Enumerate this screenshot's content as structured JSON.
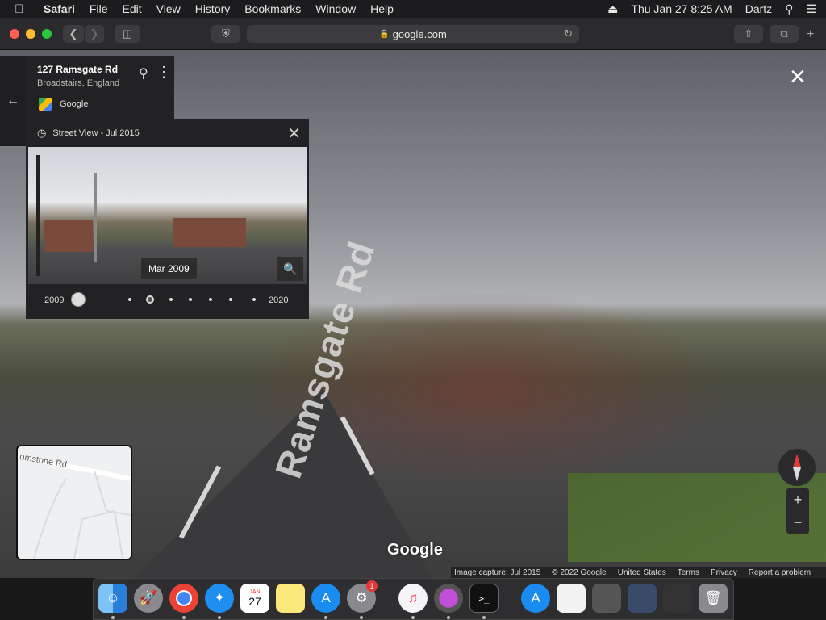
{
  "menubar": {
    "app": "Safari",
    "items": [
      "File",
      "Edit",
      "View",
      "History",
      "Bookmarks",
      "Window",
      "Help"
    ],
    "datetime": "Thu Jan 27  8:25 AM",
    "user": "Dartz"
  },
  "browser": {
    "url": "google.com"
  },
  "place": {
    "title": "127 Ramsgate Rd",
    "subtitle": "Broadstairs, England",
    "provider": "Google"
  },
  "timemachine": {
    "header": "Street View - Jul 2015",
    "preview_date": "Mar 2009",
    "start_year": "2009",
    "end_year": "2020",
    "ticks": 9,
    "selected_tick": 0,
    "highlighted_tick": 3
  },
  "minimap": {
    "road_label": "omstone Rd"
  },
  "street": {
    "road_label": "Ramsgate Rd",
    "logo": "Google"
  },
  "footer": {
    "capture": "Image capture: Jul 2015",
    "copyright": "© 2022 Google",
    "region": "United States",
    "terms": "Terms",
    "privacy": "Privacy",
    "report": "Report a problem"
  },
  "dock": {
    "apps": [
      "Finder",
      "Launchpad",
      "Chrome",
      "Safari",
      "Calendar",
      "Notes",
      "App Store",
      "System Preferences",
      "Music",
      "Installer",
      "Terminal",
      "Applications",
      "Documents",
      "Screenshots",
      "Preview",
      "Photos",
      "Trash"
    ],
    "calendar_month": "JAN",
    "calendar_day": "27",
    "badge_count": "1",
    "colors": {
      "finder": "#2a7fd9",
      "chrome": "#e0e0e0",
      "safari": "#1e8ef0",
      "appstore": "#1a8cf0",
      "music": "#f5f5f7",
      "terminal": "#111111"
    }
  }
}
